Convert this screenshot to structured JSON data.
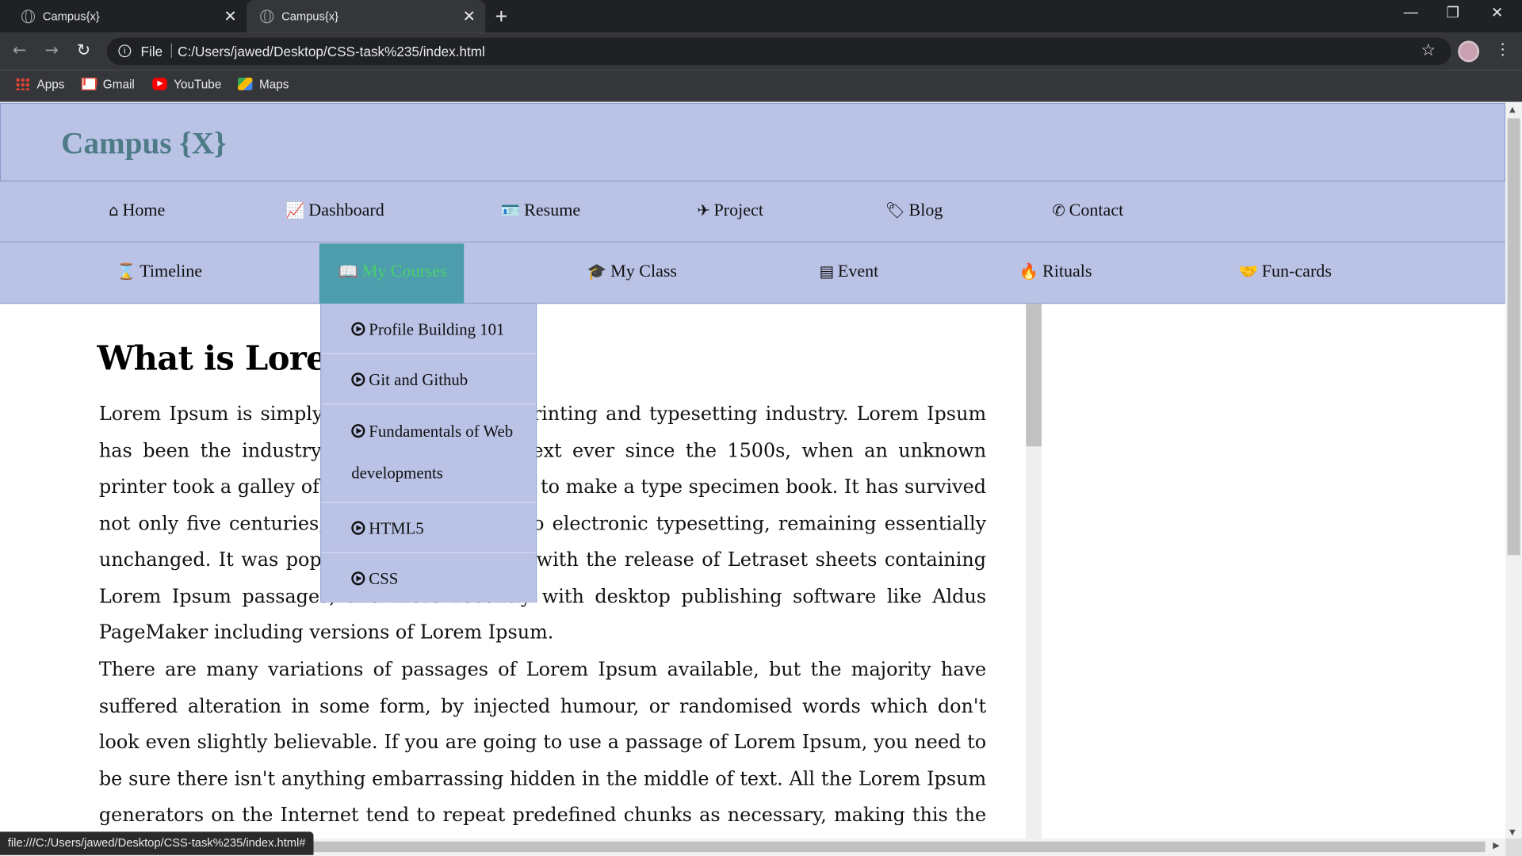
{
  "browser": {
    "tabs": [
      {
        "title": "Campus{x}",
        "active": false
      },
      {
        "title": "Campus{x}",
        "active": true
      }
    ],
    "new_tab": "+",
    "address": {
      "scheme_label": "File",
      "url": "C:/Users/jawed/Desktop/CSS-task%235/index.html"
    },
    "bookmarks": [
      {
        "label": "Apps",
        "icon": "apps-grid-icon"
      },
      {
        "label": "Gmail",
        "icon": "gmail-icon"
      },
      {
        "label": "YouTube",
        "icon": "youtube-icon"
      },
      {
        "label": "Maps",
        "icon": "maps-icon"
      }
    ],
    "status_url": "file:///C:/Users/jawed/Desktop/CSS-task%235/index.html#"
  },
  "site": {
    "logo": "Campus {X}",
    "nav_primary": [
      {
        "label": "Home",
        "icon": "home-icon",
        "glyph": "⌂"
      },
      {
        "label": "Dashboard",
        "icon": "line-chart-icon",
        "glyph": "📈"
      },
      {
        "label": "Resume",
        "icon": "id-card-icon",
        "glyph": "🪪"
      },
      {
        "label": "Project",
        "icon": "plane-icon",
        "glyph": "✈"
      },
      {
        "label": "Blog",
        "icon": "tag-icon",
        "glyph": "🏷"
      },
      {
        "label": "Contact",
        "icon": "phone-volume-icon",
        "glyph": "✆"
      }
    ],
    "nav_secondary": [
      {
        "label": "Timeline",
        "icon": "hourglass-icon",
        "glyph": "⌛"
      },
      {
        "label": "My Courses",
        "icon": "book-icon",
        "glyph": "📖",
        "active": true
      },
      {
        "label": "My Class",
        "icon": "graduation-cap-icon",
        "glyph": "🎓"
      },
      {
        "label": "Event",
        "icon": "list-alt-icon",
        "glyph": "▤"
      },
      {
        "label": "Rituals",
        "icon": "fire-icon",
        "glyph": "🔥"
      },
      {
        "label": "Fun-cards",
        "icon": "handshake-icon",
        "glyph": "🤝"
      }
    ],
    "dropdown": [
      "Profile Building 101",
      "Git and Github",
      "Fundamentals of Web developments",
      "HTML5",
      "CSS"
    ],
    "article": {
      "heading": "What is Lorem Ipsum?",
      "paragraphs": [
        "Lorem Ipsum is simply dummy text of the printing and typesetting industry. Lorem Ipsum has been the industry's standard dummy text ever since the 1500s, when an unknown printer took a galley of type and scrambled it to make a type specimen book. It has survived not only five centuries, but also the leap into electronic typesetting, remaining essentially unchanged. It was popularised in the 1960s with the release of Letraset sheets containing Lorem Ipsum passages, and more recently with desktop publishing software like Aldus PageMaker including versions of Lorem Ipsum.",
        "There are many variations of passages of Lorem Ipsum available, but the majority have suffered alteration in some form, by injected humour, or randomised words which don't look even slightly believable. If you are going to use a passage of Lorem Ipsum, you need to be sure there isn't anything embarrassing hidden in the middle of text. All the Lorem Ipsum generators on the Internet tend to repeat predefined chunks as necessary, making this the first true generator on the Internet. It uses a"
      ]
    }
  },
  "colors": {
    "nav_bg": "#bac2e6",
    "logo": "#4d7c86",
    "active_tab_bg": "#4d9dad",
    "active_tab_text": "#4bd06a"
  }
}
